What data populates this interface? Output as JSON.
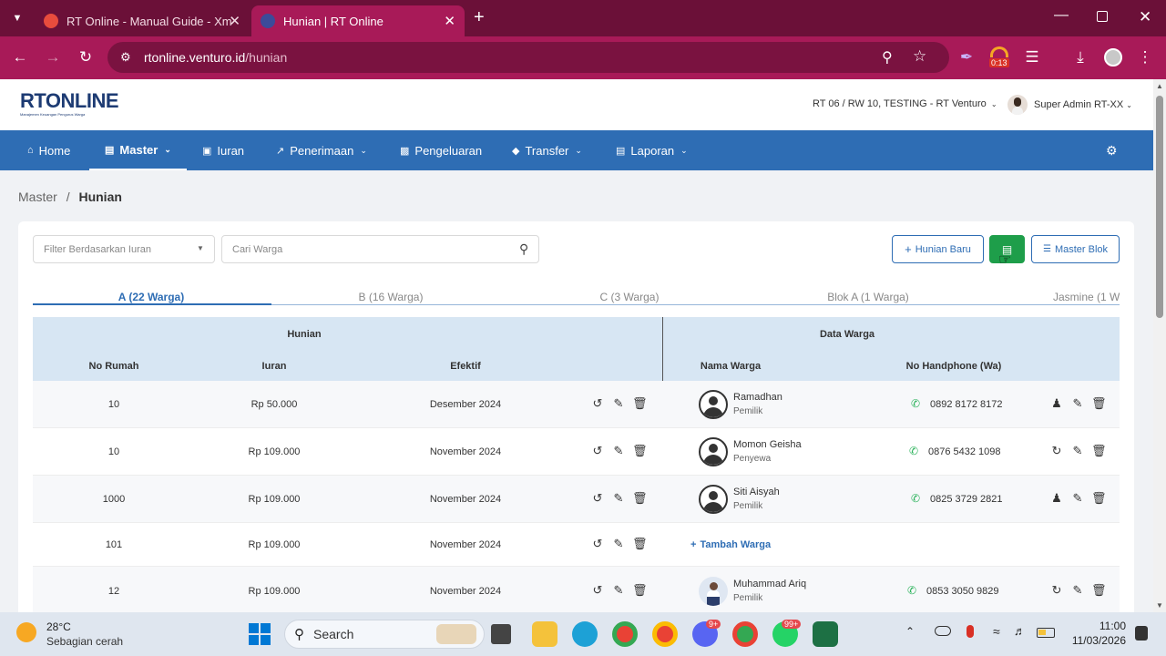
{
  "browser": {
    "tabs": [
      {
        "title": "RT Online - Manual Guide - Xm",
        "active": false
      },
      {
        "title": "Hunian | RT Online",
        "active": true
      }
    ],
    "url_host": "rtonline.venturo.id",
    "url_path": "/hunian",
    "extension_badge": "0:13"
  },
  "app": {
    "logo_text": "RTONLINE",
    "logo_tagline": "Manajemen Keuangan Pengurus Warga",
    "org_selector": "RT 06 / RW 10, TESTING - RT Venturo",
    "user_name": "Super Admin RT-XX",
    "nav": [
      {
        "label": "Home",
        "icon": "home-icon"
      },
      {
        "label": "Master",
        "icon": "document-icon",
        "active": true
      },
      {
        "label": "Iuran",
        "icon": "card-icon"
      },
      {
        "label": "Penerimaan",
        "icon": "chart-icon"
      },
      {
        "label": "Pengeluaran",
        "icon": "receipt-icon"
      },
      {
        "label": "Transfer",
        "icon": "tag-icon"
      },
      {
        "label": "Laporan",
        "icon": "report-icon"
      }
    ],
    "breadcrumb": {
      "parent": "Master",
      "current": "Hunian"
    }
  },
  "filters": {
    "iuran_placeholder": "Filter Berdasarkan Iuran",
    "search_placeholder": "Cari Warga"
  },
  "actions": {
    "new_label": "Hunian Baru",
    "master_blok_label": "Master Blok"
  },
  "group_tabs": [
    "A (22 Warga)",
    "B (16 Warga)",
    "C (3 Warga)",
    "Blok A (1 Warga)",
    "Jasmine (1 W"
  ],
  "table": {
    "group_hunian": "Hunian",
    "group_warga": "Data Warga",
    "headers": {
      "no_rumah": "No Rumah",
      "iuran": "Iuran",
      "efektif": "Efektif",
      "nama": "Nama Warga",
      "hp": "No Handphone (Wa)"
    },
    "add_warga_label": "Tambah Warga",
    "rows": [
      {
        "no": "10",
        "iuran": "Rp 50.000",
        "efektif": "Desember 2024",
        "nama": "Ramadhan",
        "role": "Pemilik",
        "hp": "0892 8172 8172"
      },
      {
        "no": "10",
        "iuran": "Rp 109.000",
        "efektif": "November 2024",
        "nama": "Momon Geisha",
        "role": "Penyewa",
        "hp": "0876 5432 1098"
      },
      {
        "no": "1000",
        "iuran": "Rp 109.000",
        "efektif": "November 2024",
        "nama": "Siti Aisyah",
        "role": "Pemilik",
        "hp": "0825 3729 2821"
      },
      {
        "no": "101",
        "iuran": "Rp 109.000",
        "efektif": "November 2024",
        "nama": "",
        "role": "",
        "hp": ""
      },
      {
        "no": "12",
        "iuran": "Rp 109.000",
        "efektif": "November 2024",
        "nama": "Muhammad Ariq",
        "role": "Pemilik",
        "hp": "0853 3050 9829"
      }
    ]
  },
  "taskbar": {
    "weather_temp": "28°C",
    "weather_desc": "Sebagian cerah",
    "search_label": "Search",
    "badge_discord": "9+",
    "badge_whatsapp": "99+",
    "time": "11:00",
    "date": "11/03/2026"
  }
}
